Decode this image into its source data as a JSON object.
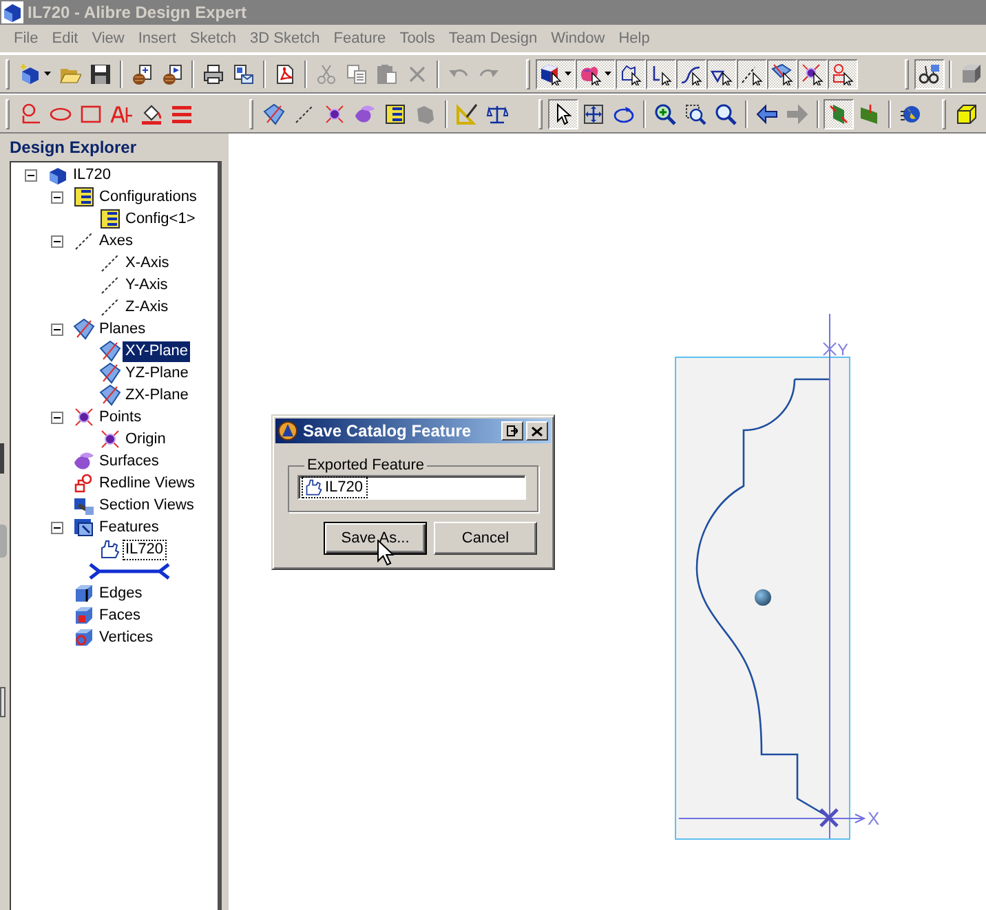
{
  "window": {
    "title": "IL720 - Alibre Design Expert",
    "active": false
  },
  "menu": [
    "File",
    "Edit",
    "View",
    "Insert",
    "Sketch",
    "3D Sketch",
    "Feature",
    "Tools",
    "Team Design",
    "Window",
    "Help"
  ],
  "toolbar_rows": [
    {
      "toolbars": [
        {
          "groups": [
            [
              {
                "kind": "new",
                "pressed": false,
                "disabled": false,
                "dropdown": true
              },
              {
                "kind": "open",
                "pressed": false,
                "disabled": false,
                "dropdown": false
              },
              {
                "kind": "save",
                "pressed": false,
                "disabled": false,
                "dropdown": false
              }
            ],
            [
              {
                "kind": "catalog_add",
                "pressed": false,
                "disabled": false,
                "dropdown": false
              },
              {
                "kind": "catalog_open",
                "pressed": false,
                "disabled": false,
                "dropdown": false
              }
            ],
            [
              {
                "kind": "print",
                "pressed": false,
                "disabled": false,
                "dropdown": false
              },
              {
                "kind": "send",
                "pressed": false,
                "disabled": false,
                "dropdown": false
              }
            ],
            [
              {
                "kind": "pdf",
                "pressed": false,
                "disabled": false,
                "dropdown": false
              }
            ],
            [
              {
                "kind": "cut",
                "pressed": false,
                "disabled": true,
                "dropdown": false
              },
              {
                "kind": "copy",
                "pressed": false,
                "disabled": true,
                "dropdown": false
              },
              {
                "kind": "paste",
                "pressed": false,
                "disabled": true,
                "dropdown": false
              },
              {
                "kind": "delete",
                "pressed": false,
                "disabled": true,
                "dropdown": false
              }
            ],
            [
              {
                "kind": "undo",
                "pressed": false,
                "disabled": true,
                "dropdown": false
              },
              {
                "kind": "redo",
                "pressed": false,
                "disabled": true,
                "dropdown": false
              }
            ]
          ]
        },
        {
          "groups": [
            [
              {
                "kind": "part",
                "pressed": true,
                "disabled": false,
                "dropdown": true
              },
              {
                "kind": "color",
                "pressed": true,
                "disabled": false,
                "dropdown": true
              },
              {
                "kind": "filter_face",
                "pressed": true,
                "disabled": false,
                "dropdown": false
              },
              {
                "kind": "filter_edge",
                "pressed": true,
                "disabled": false,
                "dropdown": false
              },
              {
                "kind": "filter_curve",
                "pressed": true,
                "disabled": false,
                "dropdown": false
              },
              {
                "kind": "filter_vertex",
                "pressed": true,
                "disabled": false,
                "dropdown": false
              },
              {
                "kind": "filter_axis",
                "pressed": true,
                "disabled": false,
                "dropdown": false
              },
              {
                "kind": "filter_plane",
                "pressed": true,
                "disabled": false,
                "dropdown": false
              },
              {
                "kind": "filter_point",
                "pressed": true,
                "disabled": false,
                "dropdown": false
              },
              {
                "kind": "filter_redline",
                "pressed": true,
                "disabled": false,
                "dropdown": false
              }
            ]
          ]
        },
        {
          "groups": [
            [
              {
                "kind": "glasses",
                "pressed": true,
                "disabled": false,
                "dropdown": false
              }
            ],
            [
              {
                "kind": "cube_gray",
                "pressed": false,
                "disabled": false,
                "dropdown": false
              }
            ]
          ]
        }
      ]
    },
    {
      "toolbars": [
        {
          "groups": [
            [
              {
                "kind": "circle_2pt",
                "pressed": false,
                "disabled": false,
                "dropdown": false
              },
              {
                "kind": "ellipse",
                "pressed": false,
                "disabled": false,
                "dropdown": false
              },
              {
                "kind": "rectangle",
                "pressed": false,
                "disabled": false,
                "dropdown": false
              },
              {
                "kind": "text",
                "pressed": false,
                "disabled": false,
                "dropdown": false
              },
              {
                "kind": "fill",
                "pressed": false,
                "disabled": false,
                "dropdown": false
              },
              {
                "kind": "lines",
                "pressed": false,
                "disabled": false,
                "dropdown": false
              }
            ]
          ]
        },
        {
          "groups": [
            [
              {
                "kind": "plane",
                "pressed": false,
                "disabled": false,
                "dropdown": false
              },
              {
                "kind": "axis",
                "pressed": false,
                "disabled": false,
                "dropdown": false
              },
              {
                "kind": "point",
                "pressed": false,
                "disabled": false,
                "dropdown": false
              },
              {
                "kind": "surface",
                "pressed": false,
                "disabled": false,
                "dropdown": false
              },
              {
                "kind": "table",
                "pressed": false,
                "disabled": false,
                "dropdown": false
              },
              {
                "kind": "shape",
                "pressed": false,
                "disabled": true,
                "dropdown": false
              }
            ],
            [
              {
                "kind": "measure",
                "pressed": false,
                "disabled": false,
                "dropdown": false
              },
              {
                "kind": "balance",
                "pressed": false,
                "disabled": false,
                "dropdown": false
              }
            ]
          ]
        },
        {
          "groups": [
            [
              {
                "kind": "select",
                "pressed": true,
                "disabled": false,
                "dropdown": false
              },
              {
                "kind": "pan",
                "pressed": false,
                "disabled": false,
                "dropdown": false
              },
              {
                "kind": "rotate",
                "pressed": false,
                "disabled": false,
                "dropdown": false
              }
            ],
            [
              {
                "kind": "zoom_in",
                "pressed": false,
                "disabled": false,
                "dropdown": false
              },
              {
                "kind": "zoom_window",
                "pressed": false,
                "disabled": false,
                "dropdown": false
              },
              {
                "kind": "zoom",
                "pressed": false,
                "disabled": false,
                "dropdown": false
              }
            ],
            [
              {
                "kind": "back",
                "pressed": false,
                "disabled": false,
                "dropdown": false
              },
              {
                "kind": "forward",
                "pressed": false,
                "disabled": true,
                "dropdown": false
              }
            ],
            [
              {
                "kind": "view_a",
                "pressed": true,
                "disabled": false,
                "dropdown": false
              },
              {
                "kind": "view_b",
                "pressed": false,
                "disabled": false,
                "dropdown": false
              }
            ],
            [
              {
                "kind": "globe",
                "pressed": false,
                "disabled": false,
                "dropdown": false
              }
            ]
          ]
        },
        {
          "groups": [
            [
              {
                "kind": "cube_yellow",
                "pressed": false,
                "disabled": false,
                "dropdown": false
              }
            ]
          ]
        }
      ]
    }
  ],
  "explorer": {
    "title": "Design Explorer",
    "tree": [
      {
        "label": "IL720",
        "kind": "part",
        "expanded": true,
        "selected": false,
        "focused": false,
        "children": [
          {
            "label": "Configurations",
            "kind": "configurations",
            "expanded": true,
            "selected": false,
            "focused": false,
            "children": [
              {
                "label": "Config<1>",
                "kind": "configuration",
                "selected": false,
                "focused": false
              }
            ]
          },
          {
            "label": "Axes",
            "kind": "axes",
            "expanded": true,
            "selected": false,
            "focused": false,
            "children": [
              {
                "label": "X-Axis",
                "kind": "axis",
                "selected": false,
                "focused": false
              },
              {
                "label": "Y-Axis",
                "kind": "axis",
                "selected": false,
                "focused": false
              },
              {
                "label": "Z-Axis",
                "kind": "axis",
                "selected": false,
                "focused": false
              }
            ]
          },
          {
            "label": "Planes",
            "kind": "planes",
            "expanded": true,
            "selected": false,
            "focused": false,
            "children": [
              {
                "label": "XY-Plane",
                "kind": "plane",
                "selected": true,
                "focused": false
              },
              {
                "label": "YZ-Plane",
                "kind": "plane",
                "selected": false,
                "focused": false
              },
              {
                "label": "ZX-Plane",
                "kind": "plane",
                "selected": false,
                "focused": false
              }
            ]
          },
          {
            "label": "Points",
            "kind": "points",
            "expanded": true,
            "selected": false,
            "focused": false,
            "children": [
              {
                "label": "Origin",
                "kind": "point",
                "selected": false,
                "focused": false
              }
            ]
          },
          {
            "label": "Surfaces",
            "kind": "surfaces",
            "selected": false,
            "focused": false
          },
          {
            "label": "Redline Views",
            "kind": "redline",
            "selected": false,
            "focused": false
          },
          {
            "label": "Section Views",
            "kind": "section",
            "selected": false,
            "focused": false
          },
          {
            "label": "Features",
            "kind": "features",
            "expanded": true,
            "selected": false,
            "focused": false,
            "children": [
              {
                "label": "IL720",
                "kind": "feature",
                "selected": false,
                "focused": true
              }
            ]
          },
          {
            "kind": "rollback"
          },
          {
            "label": "Edges",
            "kind": "edges",
            "selected": false,
            "focused": false
          },
          {
            "label": "Faces",
            "kind": "faces",
            "selected": false,
            "focused": false
          },
          {
            "label": "Vertices",
            "kind": "vertices",
            "selected": false,
            "focused": false
          }
        ]
      }
    ]
  },
  "canvas": {
    "x_axis_label": "X",
    "y_axis_label": "Y"
  },
  "dialog": {
    "title": "Save Catalog Feature",
    "active": true,
    "group_label": "Exported Feature",
    "field": {
      "value": "IL720",
      "focused": true
    },
    "buttons": [
      {
        "label": "Save As...",
        "default": true
      },
      {
        "label": "Cancel",
        "default": false
      }
    ]
  }
}
